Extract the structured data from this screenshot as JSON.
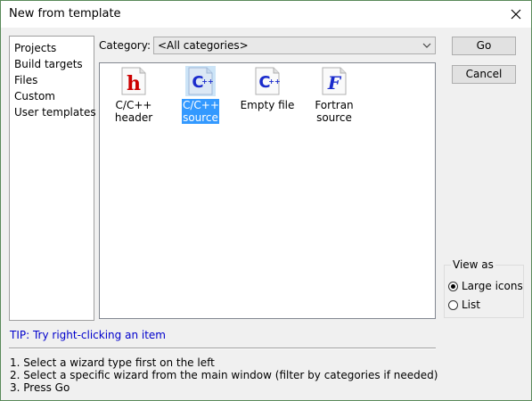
{
  "window": {
    "title": "New from template"
  },
  "sidebar": {
    "items": [
      {
        "label": "Projects"
      },
      {
        "label": "Build targets"
      },
      {
        "label": "Files"
      },
      {
        "label": "Custom"
      },
      {
        "label": "User templates"
      }
    ]
  },
  "category": {
    "label": "Category:",
    "selected": "<All categories>"
  },
  "templates": [
    {
      "label": "C/C++ header",
      "icon": "h-file-icon",
      "selected": false
    },
    {
      "label": "C/C++ source",
      "icon": "cpp-file-icon",
      "selected": true
    },
    {
      "label": "Empty file",
      "icon": "cpp-file-icon",
      "selected": false
    },
    {
      "label": "Fortran source",
      "icon": "fortran-file-icon",
      "selected": false
    }
  ],
  "buttons": {
    "go": "Go",
    "cancel": "Cancel"
  },
  "view_as": {
    "legend": "View as",
    "options": [
      {
        "label": "Large icons",
        "checked": true
      },
      {
        "label": "List",
        "checked": false
      }
    ]
  },
  "tip": "TIP: Try right-clicking an item",
  "instructions": [
    "1. Select a wizard type first on the left",
    "2. Select a specific wizard from the main window (filter by categories if needed)",
    "3. Press Go"
  ],
  "colors": {
    "selection": "#3399ff",
    "tip": "#0000cc",
    "h_icon": "#cc0000",
    "cpp_icon": "#1a2bcc"
  }
}
